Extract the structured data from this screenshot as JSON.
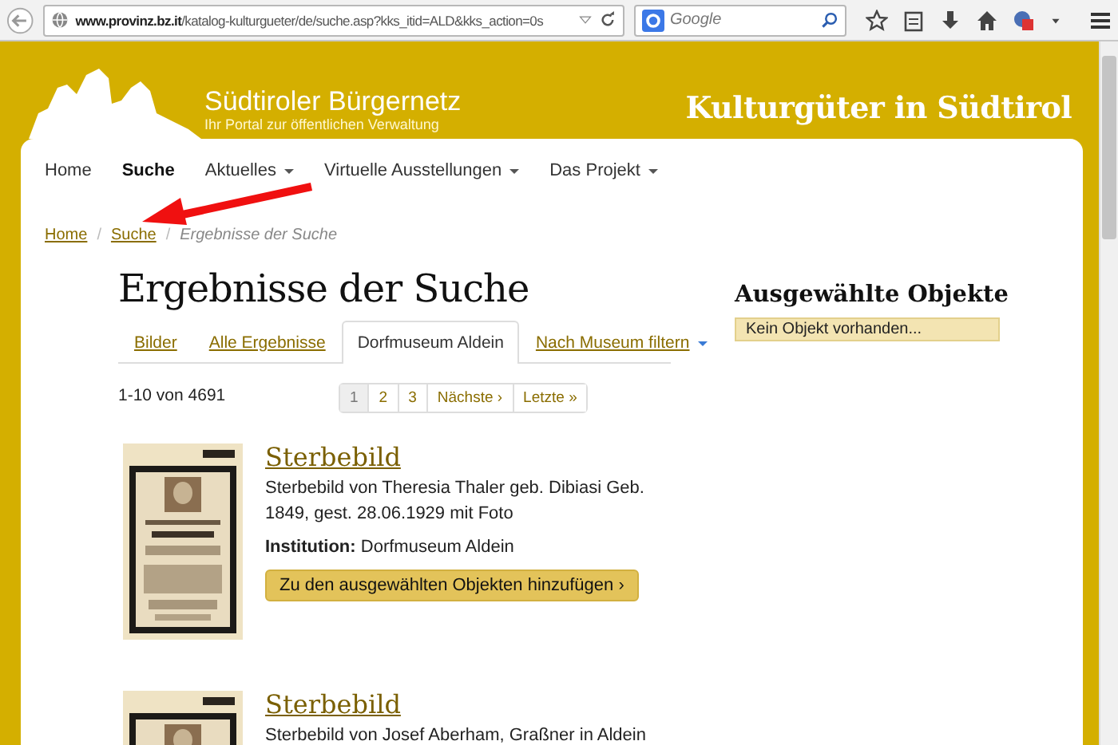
{
  "browser": {
    "url_host": "www.provinz.bz.it",
    "url_path": "/katalog-kulturgueter/de/suche.asp?kks_itid=ALD&kks_action=0s",
    "search_placeholder": "Google"
  },
  "header": {
    "logo_title": "Südtiroler Bürgernetz",
    "logo_subtitle": "Ihr Portal zur öffentlichen Verwaltung",
    "site_title": "Kulturgüter in Südtirol"
  },
  "nav": [
    {
      "label": "Home",
      "selected": false,
      "dropdown": false
    },
    {
      "label": "Suche",
      "selected": true,
      "dropdown": false
    },
    {
      "label": "Aktuelles",
      "selected": false,
      "dropdown": true
    },
    {
      "label": "Virtuelle Ausstellungen",
      "selected": false,
      "dropdown": true
    },
    {
      "label": "Das Projekt",
      "selected": false,
      "dropdown": true
    }
  ],
  "breadcrumb": [
    {
      "label": "Home",
      "kind": "link"
    },
    {
      "label": "/",
      "kind": "separator"
    },
    {
      "label": "Suche",
      "kind": "link"
    },
    {
      "label": "/",
      "kind": "separator"
    },
    {
      "label": "Ergebnisse der Suche",
      "kind": "current"
    }
  ],
  "heading": "Ergebnisse der Suche",
  "tabs": [
    {
      "label": "Bilder",
      "selected": false,
      "dropdown": false
    },
    {
      "label": "Alle Ergebnisse",
      "selected": false,
      "dropdown": false
    },
    {
      "label": "Dorfmuseum Aldein",
      "selected": true,
      "dropdown": false
    },
    {
      "label": "Nach Museum filtern",
      "selected": false,
      "dropdown": true
    }
  ],
  "result_count": "1-10 von 4691",
  "pagination": [
    {
      "label": "1",
      "selected": true
    },
    {
      "label": "2",
      "selected": false
    },
    {
      "label": "3",
      "selected": false
    },
    {
      "label": "Nächste ›",
      "selected": false
    },
    {
      "label": "Letzte »",
      "selected": false
    }
  ],
  "results": [
    {
      "title": "Sterbebild",
      "description": "Sterbebild von Theresia Thaler geb. Dibiasi Geb. 1849, gest. 28.06.1929 mit Foto",
      "institution_label": "Institution:",
      "institution": "Dorfmuseum Aldein",
      "button": "Zu den ausgewählten Objekten hinzufügen ›"
    },
    {
      "title": "Sterbebild",
      "description": "Sterbebild von Josef Aberham, Graßner in Aldein"
    }
  ],
  "sidebar": {
    "title": "Ausgewählte Objekte",
    "empty": "Kein Objekt vorhanden..."
  }
}
